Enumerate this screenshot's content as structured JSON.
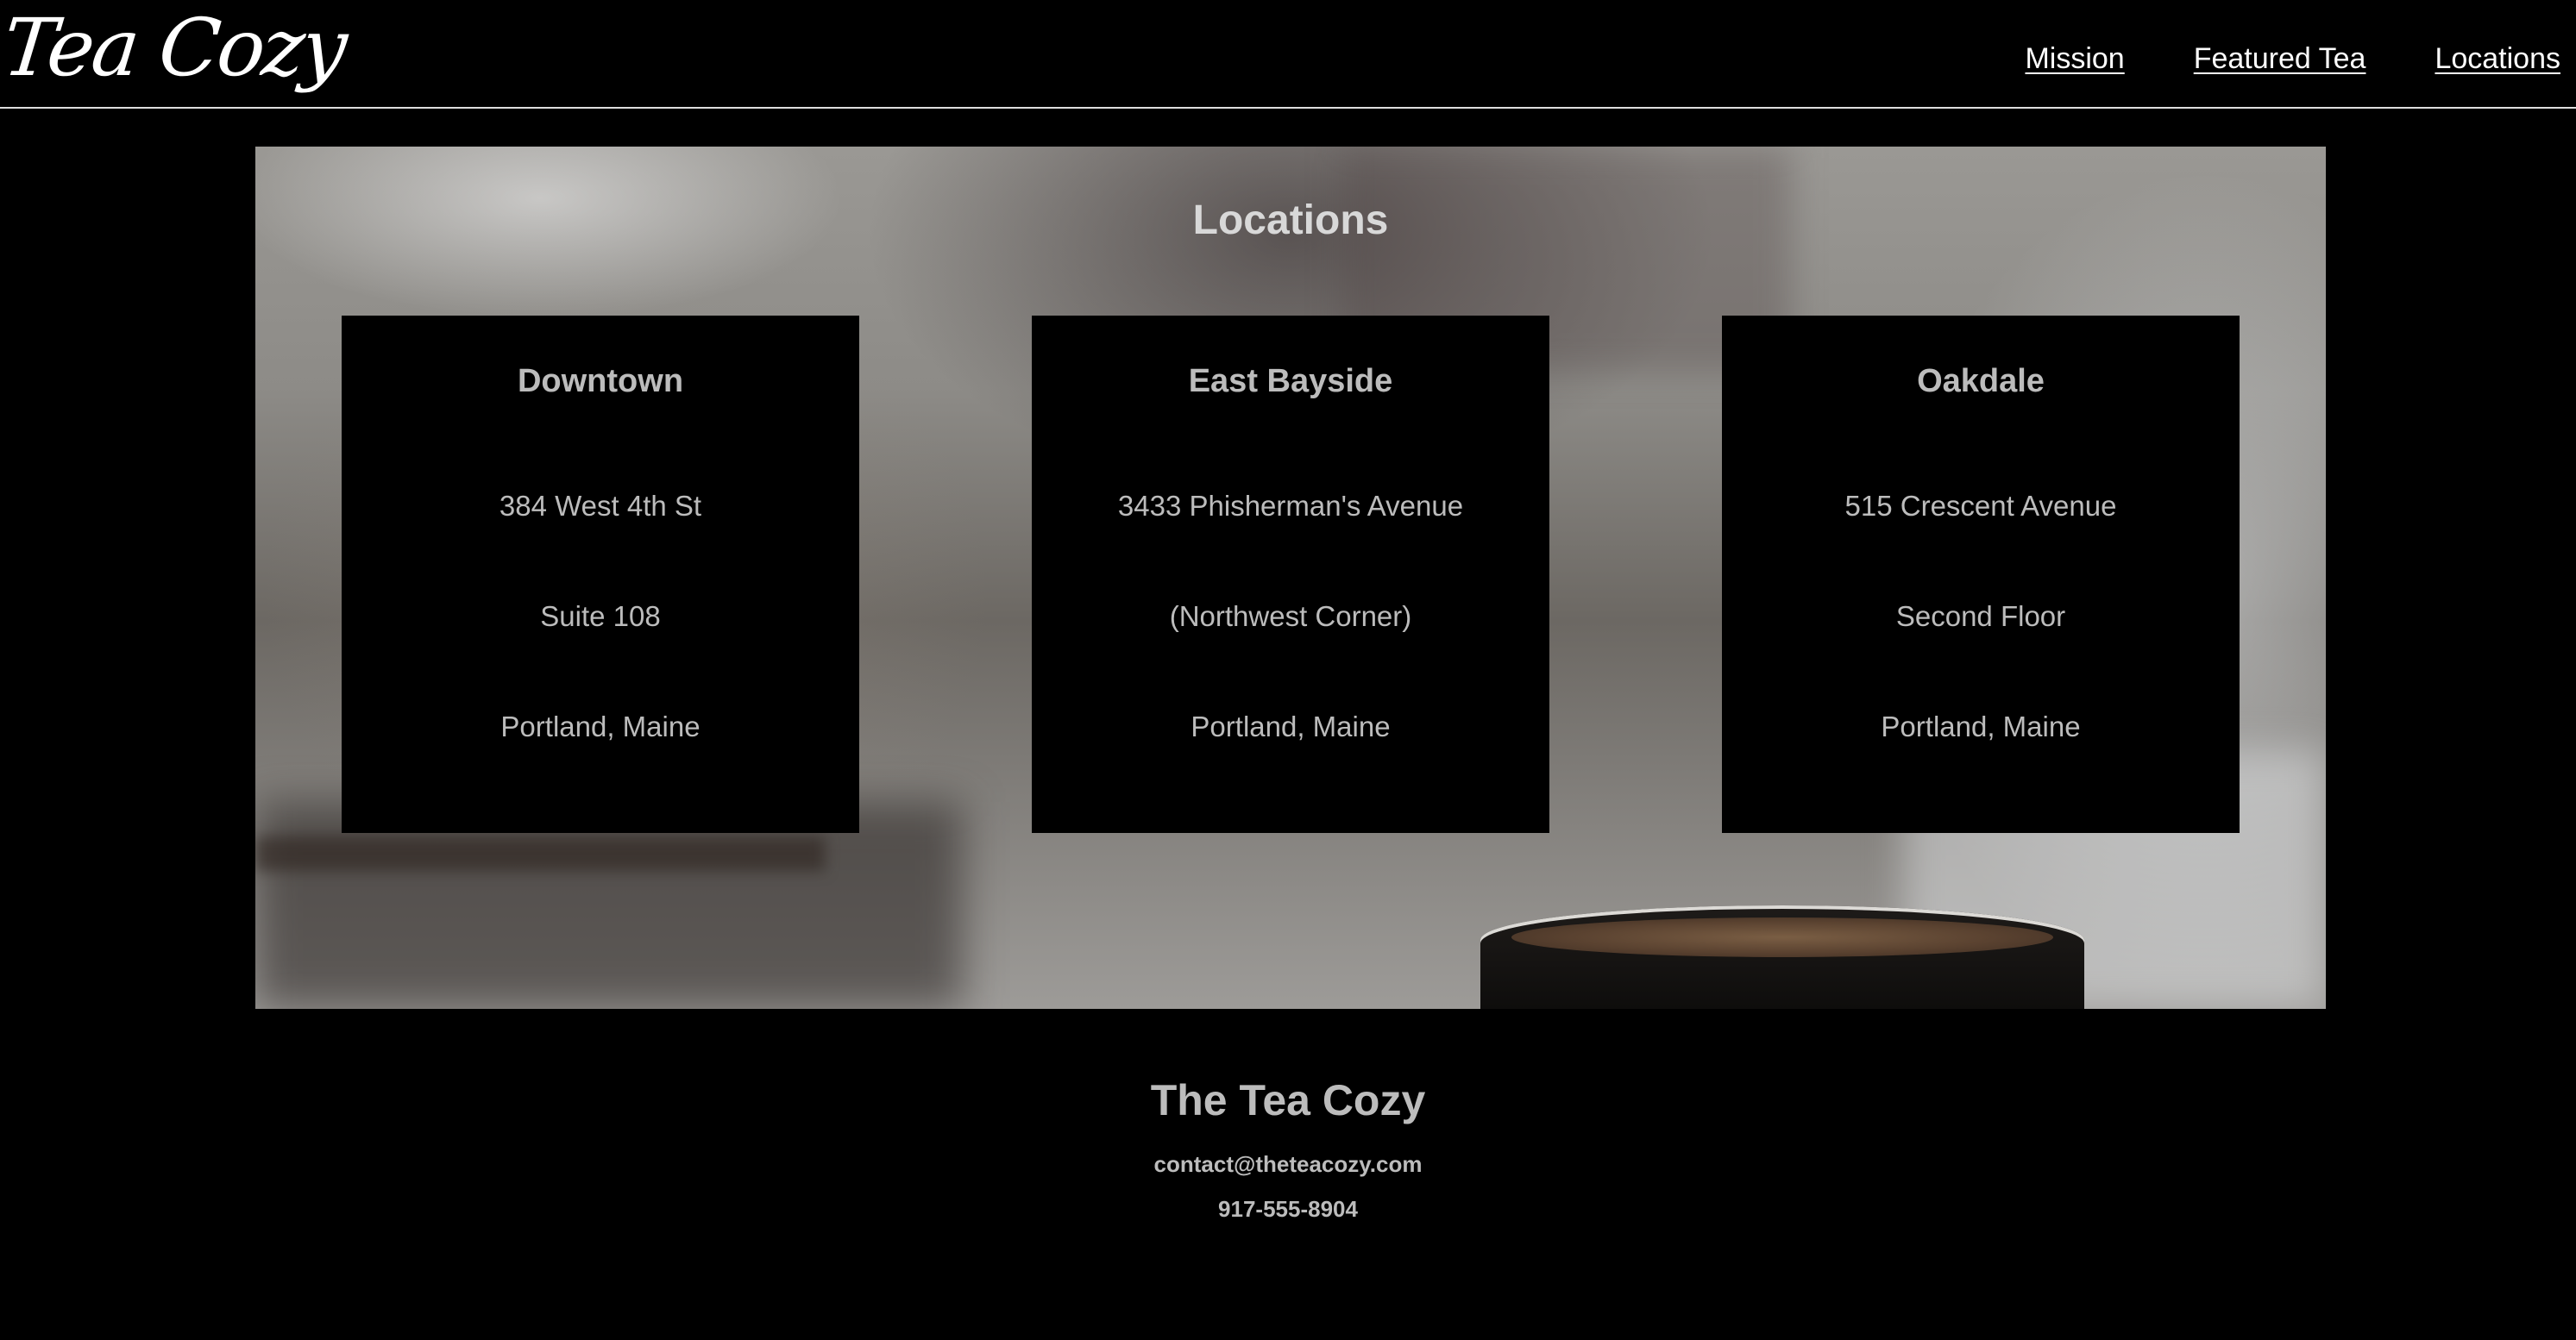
{
  "header": {
    "logo_text": "Tea Cozy",
    "nav": [
      {
        "label": "Mission"
      },
      {
        "label": "Featured Tea"
      },
      {
        "label": "Locations"
      }
    ]
  },
  "locations": {
    "title": "Locations",
    "cards": [
      {
        "name": "Downtown",
        "lines": [
          "384 West 4th St",
          "Suite 108",
          "Portland, Maine"
        ]
      },
      {
        "name": "East Bayside",
        "lines": [
          "3433 Phisherman's Avenue",
          "(Northwest Corner)",
          "Portland, Maine"
        ]
      },
      {
        "name": "Oakdale",
        "lines": [
          "515 Crescent Avenue",
          "Second Floor",
          "Portland, Maine"
        ]
      }
    ]
  },
  "footer": {
    "name": "The Tea Cozy",
    "email": "contact@theteacozy.com",
    "phone": "917-555-8904"
  },
  "colors": {
    "page_background": "#000000",
    "card_background": "#000000",
    "text_primary": "#ffffff",
    "text_muted": "#bcbcbc",
    "header_rule": "#dddddd"
  }
}
